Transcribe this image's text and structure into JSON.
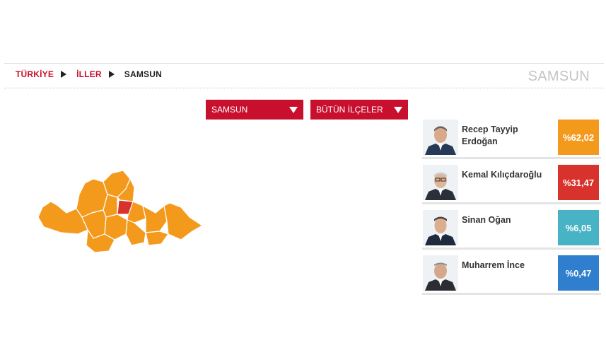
{
  "breadcrumb": {
    "items": [
      "TÜRKİYE",
      "İLLER",
      "SAMSUN"
    ]
  },
  "page_title": "SAMSUN",
  "selects": {
    "province": "SAMSUN",
    "district": "BÜTÜN İLÇELER"
  },
  "map": {
    "colors": {
      "winner_majority": "#f39a1d",
      "winner_second": "#d8322c",
      "border": "#ffffff"
    }
  },
  "candidates": [
    {
      "name": "Recep Tayyip Erdoğan",
      "percent": "%62,02",
      "color": "#f39a1d",
      "icon": "candidate-photo-icon"
    },
    {
      "name": "Kemal Kılıçdaroğlu",
      "percent": "%31,47",
      "color": "#d8322c",
      "icon": "candidate-photo-icon"
    },
    {
      "name": "Sinan Oğan",
      "percent": "%6,05",
      "color": "#48b3c4",
      "icon": "candidate-photo-icon"
    },
    {
      "name": "Muharrem İnce",
      "percent": "%0,47",
      "color": "#2f7fce",
      "icon": "candidate-photo-icon"
    }
  ]
}
